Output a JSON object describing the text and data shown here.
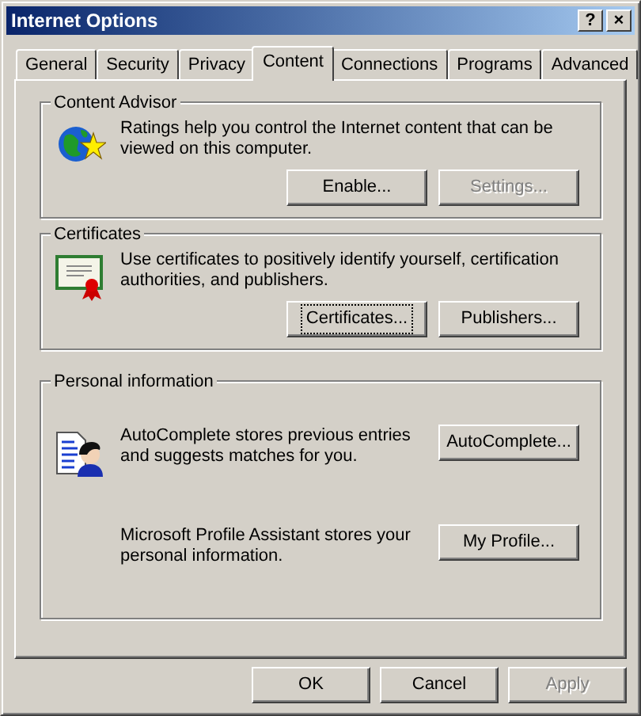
{
  "window": {
    "title": "Internet Options",
    "title_buttons": [
      "?",
      "×"
    ]
  },
  "tabs": [
    {
      "label": "General",
      "selected": false
    },
    {
      "label": "Security",
      "selected": false
    },
    {
      "label": "Privacy",
      "selected": false
    },
    {
      "label": "Content",
      "selected": true
    },
    {
      "label": "Connections",
      "selected": false
    },
    {
      "label": "Programs",
      "selected": false
    },
    {
      "label": "Advanced",
      "selected": false
    }
  ],
  "groups": [
    {
      "title": "Content Advisor",
      "kind": "single",
      "text": "Ratings help you control the Internet content that can be viewed on this computer.",
      "buttons": [
        {
          "label": "Enable...",
          "disabled": false,
          "focused": false
        },
        {
          "label": "Settings...",
          "disabled": true,
          "focused": false
        }
      ]
    },
    {
      "title": "Certificates",
      "kind": "single",
      "text": "Use certificates to positively identify yourself, certification authorities, and publishers.",
      "buttons": [
        {
          "label": "Certificates...",
          "disabled": false,
          "focused": true
        },
        {
          "label": "Publishers...",
          "disabled": false,
          "focused": false
        }
      ]
    },
    {
      "title": "Personal information",
      "kind": "rows",
      "rows": [
        {
          "text": "AutoComplete stores previous entries and suggests matches for you.",
          "button": {
            "label": "AutoComplete...",
            "disabled": false,
            "focused": false
          }
        },
        {
          "text": "Microsoft Profile Assistant stores your personal information.",
          "button": {
            "label": "My Profile...",
            "disabled": false,
            "focused": false
          }
        }
      ]
    }
  ],
  "buttons": [
    {
      "label": "OK",
      "disabled": false,
      "focused": false
    },
    {
      "label": "Cancel",
      "disabled": false,
      "focused": false
    },
    {
      "label": "Apply",
      "disabled": true,
      "focused": false
    }
  ]
}
